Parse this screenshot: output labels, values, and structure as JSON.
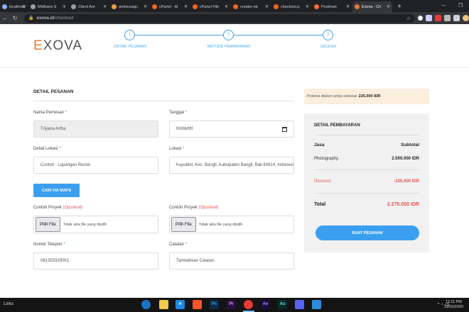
{
  "browser": {
    "tabs": [
      {
        "label": "localhost/",
        "color": "#8ab4f8"
      },
      {
        "label": "Midtrans S",
        "color": "#9aa0a6"
      },
      {
        "label": "Client Are",
        "color": "#9aa0a6"
      },
      {
        "label": "amba.kaqc",
        "color": "#e6a23c"
      },
      {
        "label": "cPanel - M",
        "color": "#f26722"
      },
      {
        "label": "cPanel File",
        "color": "#f26722"
      },
      {
        "label": "creator-str",
        "color": "#f26722"
      },
      {
        "label": "checkout.p",
        "color": "#f26722"
      },
      {
        "label": "Postman",
        "color": "#ff6c37"
      },
      {
        "label": "Exova - Ch",
        "color": "#e87b3a"
      }
    ],
    "new_tab": "+",
    "address_host": "exova.id",
    "address_path": "/checkout"
  },
  "header": {
    "logo_first": "E",
    "logo_rest": "XOVA",
    "steps": [
      {
        "num": "1",
        "label": "DETAIL PESANAN"
      },
      {
        "num": "2",
        "label": "METODE PEMBAYARAN"
      },
      {
        "num": "3",
        "label": "SELESAI"
      }
    ]
  },
  "form": {
    "title": "DETAIL PESANAN",
    "nama_label": "Nama Pemesan",
    "nama_value": "Triyana Artha",
    "tanggal_label": "Tanggal",
    "tanggal_placeholder": "hh/bb/tttt",
    "lokasi_detail_label": "Detail Lokasi",
    "lokasi_detail_placeholder": "Contoh : Lapangan Renon",
    "lokasi_label": "Lokasi",
    "lokasi_value": "Kayubihi, Kec. Bangli, Kabupaten Bangli, Bali 80614, Indonesia",
    "maps_button": "CARI VIA MAPS",
    "contoh1_label": "Contoh Proyek",
    "contoh2_label": "Contoh Proyek",
    "optional": "(Opsional)",
    "file_button": "Pilih File",
    "file_empty": "Tidak ada file yang dipilih",
    "telepon_label": "Nomor Telepon",
    "telepon_value": "081353325061",
    "catatan_label": "Catatan",
    "catatan_placeholder": "Tambahkan Catatan",
    "required_mark": "*"
  },
  "summary": {
    "promo_text": "Potensi diskon anda sebesar",
    "promo_amount": "225.000 IDR",
    "title": "DETAIL PEMBAYARAN",
    "col_service": "Jasa",
    "col_subtotal": "Subtotal",
    "service_name": "Photography",
    "service_price": "2.500.000 IDR",
    "discount_label": "Discount",
    "discount_value": "-225.000 IDR",
    "total_label": "Total",
    "total_value": "2.275.000 IDR",
    "buy_button": "BUAT PESANAN"
  },
  "taskbar": {
    "links": "Links",
    "time": "11:11 PM",
    "date": "11/16/2020"
  },
  "colors": {
    "accent": "#3b9ff0",
    "brand": "#e87b3a",
    "danger": "#e25555"
  }
}
